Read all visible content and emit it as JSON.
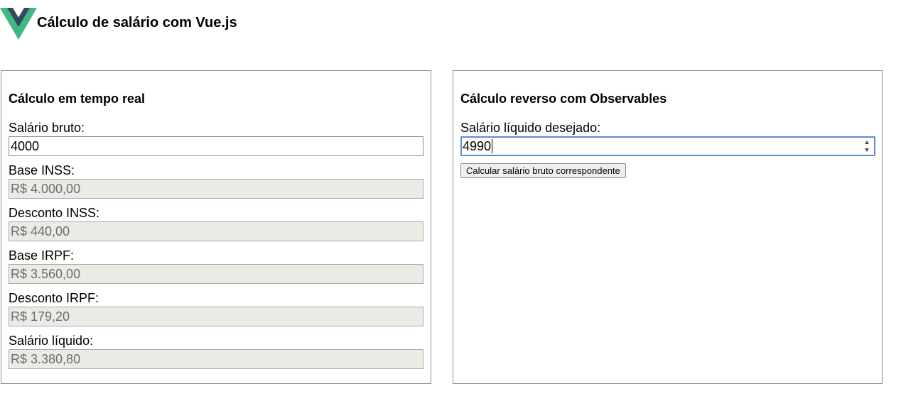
{
  "header": {
    "title": "Cálculo de salário com Vue.js",
    "logo_icon": "vue-logo-icon",
    "logo_colors": {
      "outer": "#41b883",
      "inner": "#35495e"
    }
  },
  "realtime": {
    "title": "Cálculo em tempo real",
    "fields": [
      {
        "label": "Salário bruto:",
        "value": "4000"
      },
      {
        "label": "Base INSS:",
        "value": "R$ 4.000,00"
      },
      {
        "label": "Desconto INSS:",
        "value": "R$ 440,00"
      },
      {
        "label": "Base IRPF:",
        "value": "R$ 3.560,00"
      },
      {
        "label": "Desconto IRPF:",
        "value": "R$ 179,20"
      },
      {
        "label": "Salário líquido:",
        "value": "R$ 3.380,80"
      }
    ]
  },
  "reverse": {
    "title": "Cálculo reverso com Observables",
    "desired_label": "Salário líquido desejado:",
    "desired_value": "4990",
    "button_label": "Calcular salário bruto correspondente"
  }
}
